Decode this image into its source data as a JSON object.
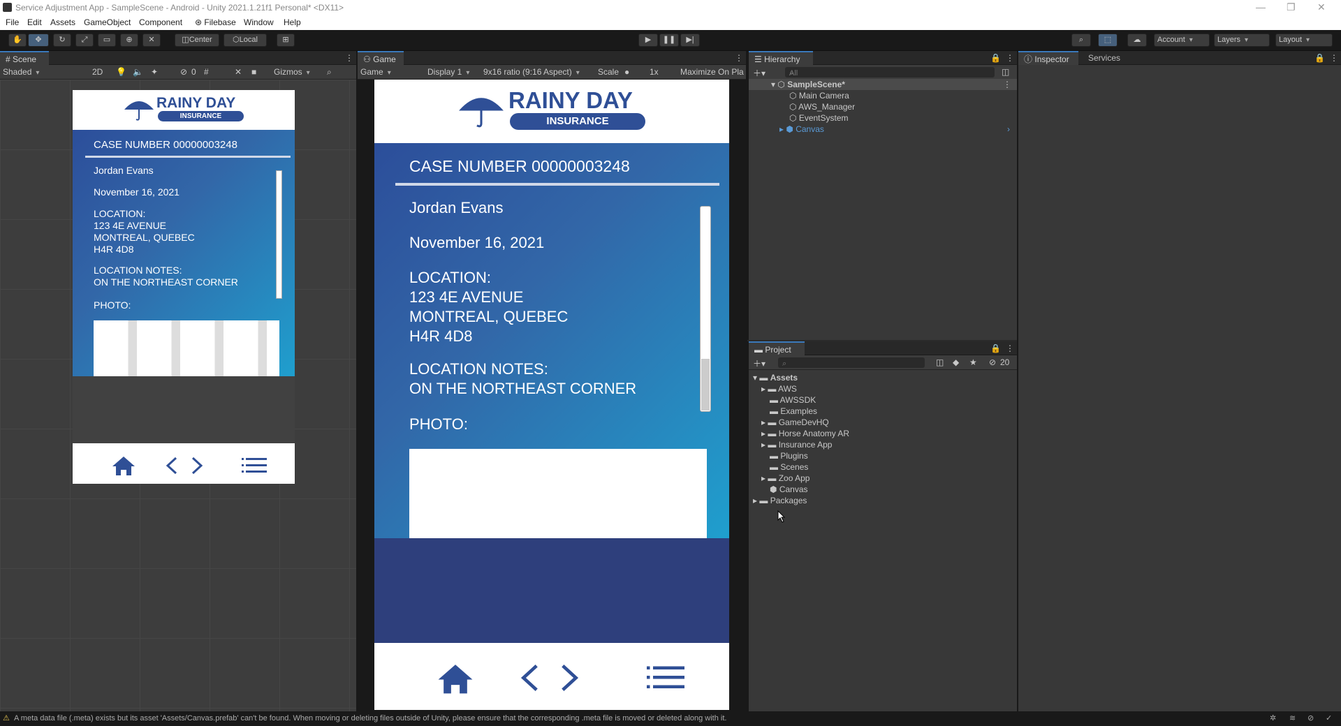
{
  "window": {
    "title": "Service Adjustment App - SampleScene - Android - Unity 2021.1.21f1 Personal* <DX11>"
  },
  "menu": [
    "File",
    "Edit",
    "Assets",
    "GameObject",
    "Component",
    "Filebase",
    "Window",
    "Help"
  ],
  "toolbar": {
    "center": "Center",
    "local": "Local",
    "account": "Account",
    "layers": "Layers",
    "layout": "Layout"
  },
  "scene": {
    "tab": "Scene",
    "shading": "Shaded",
    "mode2d": "2D",
    "count": "0",
    "gizmos": "Gizmos"
  },
  "game": {
    "tab": "Game",
    "view": "Game",
    "display": "Display 1",
    "ratio": "9x16 ratio (9:16 Aspect)",
    "scale_label": "Scale",
    "scale": "1x",
    "maximize": "Maximize On Pla"
  },
  "app": {
    "brand1": "RAINY DAY",
    "brand2": "INSURANCE",
    "case": "CASE NUMBER 00000003248",
    "name": "Jordan Evans",
    "date": "November 16, 2021",
    "loc_label": "LOCATION:",
    "loc1": "123 4E AVENUE",
    "loc2": "MONTREAL, QUEBEC",
    "loc3": "H4R 4D8",
    "notes_label": "LOCATION NOTES:",
    "notes": "ON THE NORTHEAST CORNER",
    "photo": "PHOTO:",
    "colors": {
      "blue": "#2c4e9a",
      "cyan": "#1f9fce",
      "navy": "#2e3f7c",
      "brand": "#2f4f96"
    }
  },
  "hierarchy": {
    "tab": "Hierarchy",
    "search": "All",
    "scene": "SampleScene*",
    "items": [
      "Main Camera",
      "AWS_Manager",
      "EventSystem",
      "Canvas"
    ]
  },
  "inspector": {
    "tab": "Inspector",
    "services": "Services"
  },
  "project": {
    "tab": "Project",
    "count": "20",
    "root": "Assets",
    "items": [
      "AWS",
      "AWSSDK",
      "Examples",
      "GameDevHQ",
      "Horse Anatomy AR",
      "Insurance App",
      "Plugins",
      "Scenes",
      "Zoo App",
      "Canvas"
    ],
    "packages": "Packages"
  },
  "status": {
    "message": "A meta data file (.meta) exists but its asset 'Assets/Canvas.prefab' can't be found. When moving or deleting files outside of Unity, please ensure that the corresponding .meta file is moved or deleted along with it."
  }
}
